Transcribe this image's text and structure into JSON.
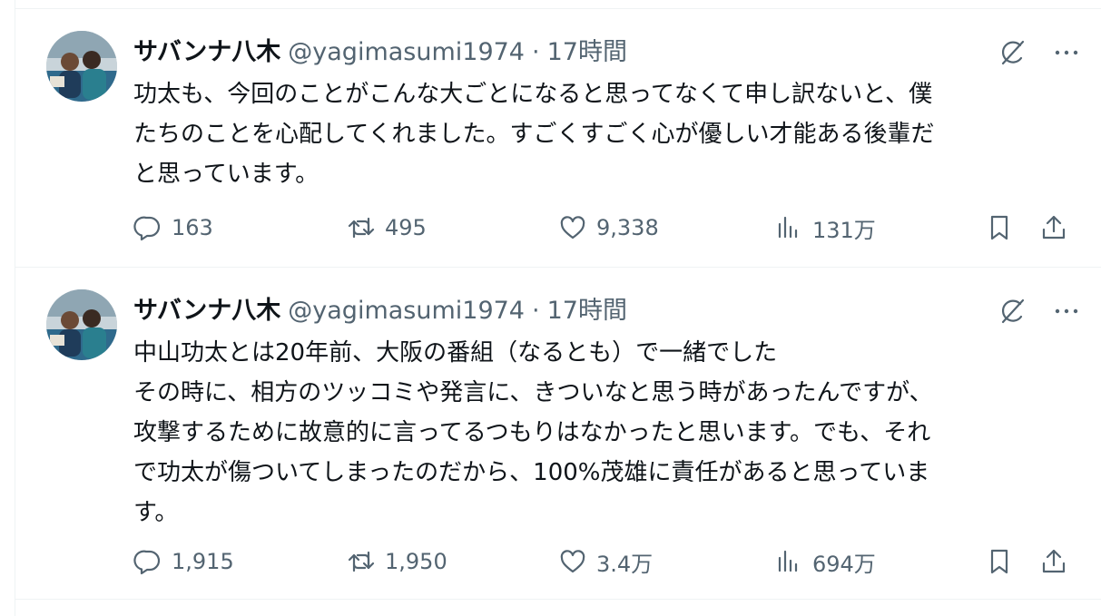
{
  "tweets": [
    {
      "author_name": "サバンナ八木",
      "handle": "@yagimasumi1974",
      "separator": "·",
      "time": "17時間",
      "lines": [
        "功太も、今回のことがこんな大ごとになると思ってなくて申し訳ないと、僕",
        "たちのことを心配してくれました。すごくすごく心が優しい才能ある後輩だ",
        "と思っています。"
      ],
      "replies": "163",
      "reposts": "495",
      "likes": "9,338",
      "views": "131万"
    },
    {
      "author_name": "サバンナ八木",
      "handle": "@yagimasumi1974",
      "separator": "·",
      "time": "17時間",
      "lines": [
        "中山功太とは20年前、大阪の番組（なるとも）で一緒でした",
        "その時に、相方のツッコミや発言に、きついなと思う時があったんですが、",
        "攻撃するために故意的に言ってるつもりはなかったと思います。でも、それ",
        "で功太が傷ついてしまったのだから、100%茂雄に責任があると思っていま",
        "す。"
      ],
      "replies": "1,915",
      "reposts": "1,950",
      "likes": "3.4万",
      "views": "694万"
    }
  ],
  "icons": {
    "reply": "reply-icon",
    "repost": "repost-icon",
    "like": "heart-icon",
    "views": "views-chart-icon",
    "bookmark": "bookmark-icon",
    "share": "share-icon",
    "grok": "grok-icon",
    "more": "more-icon"
  },
  "colors": {
    "text_primary": "#0f1419",
    "text_secondary": "#536471",
    "divider": "#eff3f4"
  }
}
